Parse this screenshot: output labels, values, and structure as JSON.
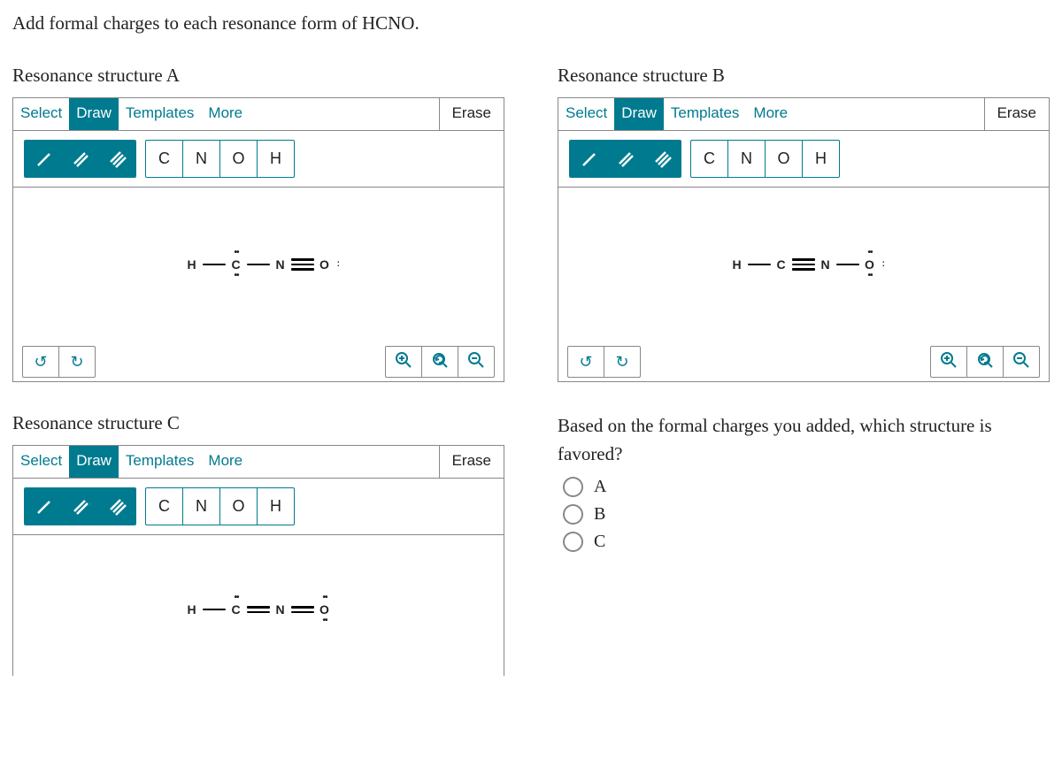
{
  "prompt": "Add formal charges to each resonance form of HCNO.",
  "panels": {
    "A": {
      "title": "Resonance structure A"
    },
    "B": {
      "title": "Resonance structure B"
    },
    "C": {
      "title": "Resonance structure C"
    }
  },
  "editor": {
    "tabs": {
      "select": "Select",
      "draw": "Draw",
      "templates": "Templates",
      "more": "More"
    },
    "erase": "Erase",
    "atoms": [
      "C",
      "N",
      "O",
      "H"
    ]
  },
  "question": {
    "text": "Based on the formal charges you added, which structure is favored?",
    "options": [
      "A",
      "B",
      "C"
    ]
  },
  "molecules": {
    "A": {
      "atoms": [
        "H",
        "C",
        "N",
        "O"
      ],
      "bonds": [
        "single",
        "single",
        "triple"
      ],
      "lonepairs": {
        "C": [
          "top",
          "bot"
        ],
        "O": [
          "right"
        ]
      }
    },
    "B": {
      "atoms": [
        "H",
        "C",
        "N",
        "O"
      ],
      "bonds": [
        "single",
        "triple",
        "single"
      ],
      "lonepairs": {
        "O": [
          "top",
          "bot",
          "right"
        ]
      }
    },
    "C": {
      "atoms": [
        "H",
        "C",
        "N",
        "O"
      ],
      "bonds": [
        "single",
        "double",
        "double"
      ],
      "lonepairs": {
        "C": [
          "top"
        ],
        "O": [
          "top",
          "bot"
        ]
      }
    }
  }
}
